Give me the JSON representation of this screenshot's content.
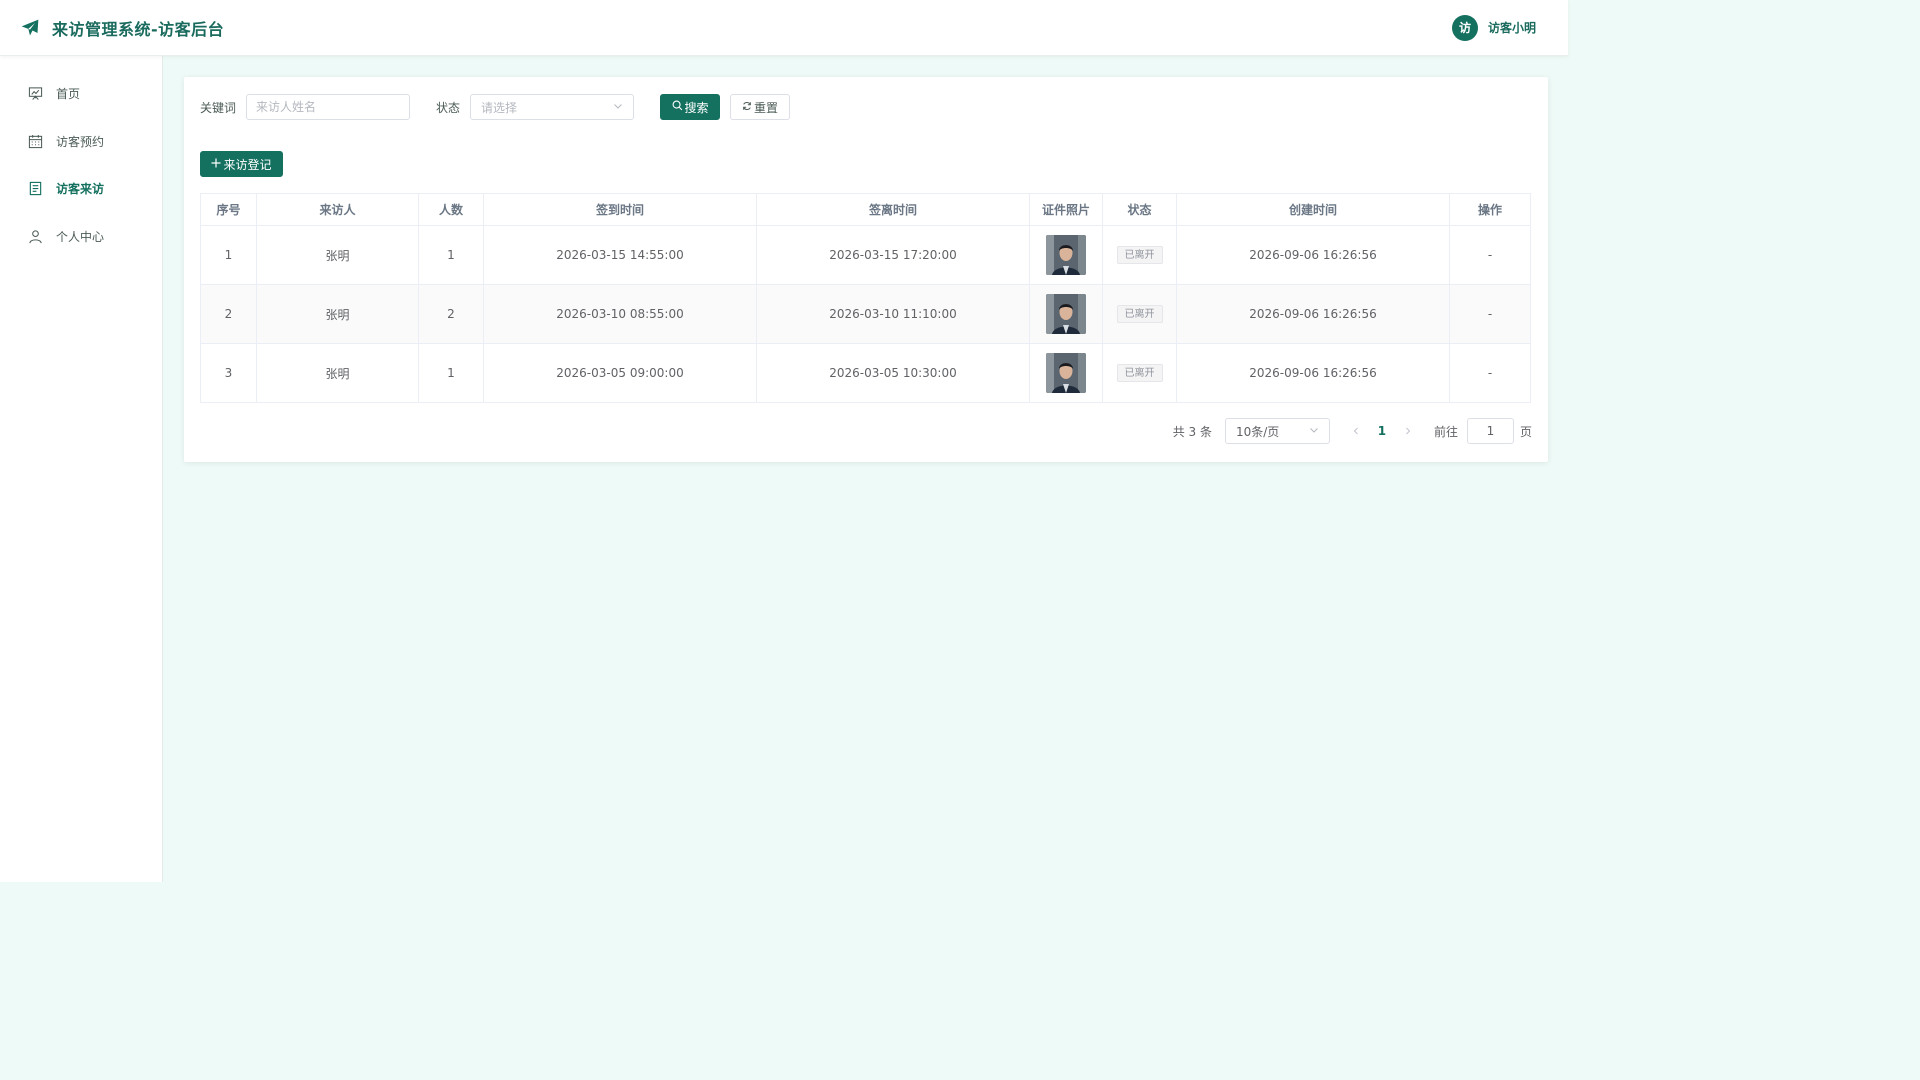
{
  "header": {
    "title": "来访管理系统-访客后台",
    "logo_icon": "paper-plane-icon",
    "user_avatar_text": "访",
    "user_name": "访客小明"
  },
  "sidebar": {
    "items": [
      {
        "label": "首页",
        "icon": "presentation-board-icon",
        "active": false
      },
      {
        "label": "访客预约",
        "icon": "calendar-icon",
        "active": false
      },
      {
        "label": "访客来访",
        "icon": "document-icon",
        "active": true
      },
      {
        "label": "个人中心",
        "icon": "user-icon",
        "active": false
      }
    ]
  },
  "filters": {
    "keyword_label": "关键词",
    "keyword_placeholder": "来访人姓名",
    "status_label": "状态",
    "status_placeholder": "请选择",
    "search_label": "搜索",
    "reset_label": "重置"
  },
  "toolbar": {
    "add_label": "来访登记"
  },
  "table": {
    "columns": [
      "序号",
      "来访人",
      "人数",
      "签到时间",
      "签离时间",
      "证件照片",
      "状态",
      "创建时间",
      "操作"
    ],
    "rows": [
      {
        "index": "1",
        "visitor": "张明",
        "count": "1",
        "checkin": "2026-03-15 14:55:00",
        "checkout": "2026-03-15 17:20:00",
        "status": "已离开",
        "created": "2026-09-06 16:26:56",
        "op": "-"
      },
      {
        "index": "2",
        "visitor": "张明",
        "count": "2",
        "checkin": "2026-03-10 08:55:00",
        "checkout": "2026-03-10 11:10:00",
        "status": "已离开",
        "created": "2026-09-06 16:26:56",
        "op": "-"
      },
      {
        "index": "3",
        "visitor": "张明",
        "count": "1",
        "checkin": "2026-03-05 09:00:00",
        "checkout": "2026-03-05 10:30:00",
        "status": "已离开",
        "created": "2026-09-06 16:26:56",
        "op": "-"
      }
    ]
  },
  "pagination": {
    "total_text": "共 3 条",
    "page_size": "10条/页",
    "current_page": "1",
    "goto_label": "前往",
    "goto_value": "1",
    "page_unit": "页"
  },
  "colors": {
    "primary": "#14705f",
    "background": "#eefaf7",
    "tag_bg": "#f4f4f5"
  }
}
